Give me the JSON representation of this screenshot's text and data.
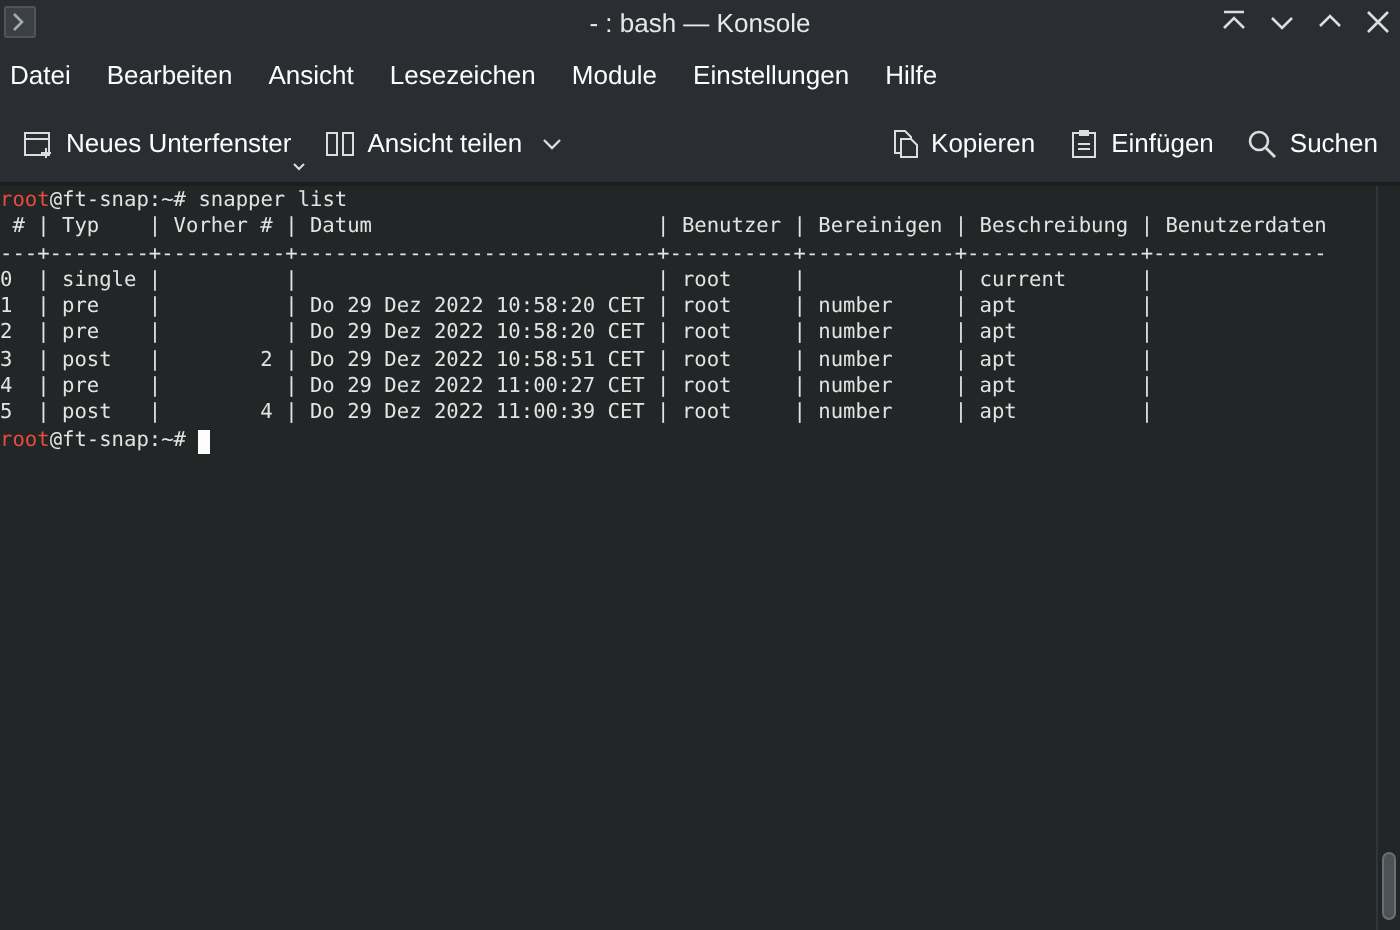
{
  "window": {
    "title": "- : bash — Konsole"
  },
  "menu": [
    "Datei",
    "Bearbeiten",
    "Ansicht",
    "Lesezeichen",
    "Module",
    "Einstellungen",
    "Hilfe"
  ],
  "toolbar": {
    "left": [
      {
        "kind": "new-tab",
        "label": "Neues Unterfenster",
        "dropdown": true
      },
      {
        "kind": "split",
        "label": "Ansicht teilen",
        "dropdown": true
      }
    ],
    "right": [
      {
        "kind": "copy",
        "label": "Kopieren"
      },
      {
        "kind": "paste",
        "label": "Einfügen"
      },
      {
        "kind": "search",
        "label": "Suchen"
      }
    ]
  },
  "terminal": {
    "lines": [
      {
        "kind": "prompt",
        "user": "root",
        "host": "@ft-snap:~# ",
        "command": "snapper list",
        "cursor": false
      },
      {
        "kind": "output",
        "text": " # | Typ    | Vorher # | Datum                       | Benutzer | Bereinigen | Beschreibung | Benutzerdaten"
      },
      {
        "kind": "output",
        "text": "---+--------+----------+-----------------------------+----------+------------+--------------+--------------"
      },
      {
        "kind": "output",
        "text": "0  | single |          |                             | root     |            | current      |"
      },
      {
        "kind": "output",
        "text": "1  | pre    |          | Do 29 Dez 2022 10:58:20 CET | root     | number     | apt          |"
      },
      {
        "kind": "output",
        "text": "2  | pre    |          | Do 29 Dez 2022 10:58:20 CET | root     | number     | apt          |"
      },
      {
        "kind": "output",
        "text": "3  | post   |        2 | Do 29 Dez 2022 10:58:51 CET | root     | number     | apt          |"
      },
      {
        "kind": "output",
        "text": "4  | pre    |          | Do 29 Dez 2022 11:00:27 CET | root     | number     | apt          |"
      },
      {
        "kind": "output",
        "text": "5  | post   |        4 | Do 29 Dez 2022 11:00:39 CET | root     | number     | apt          |"
      },
      {
        "kind": "prompt",
        "user": "root",
        "host": "@ft-snap:~# ",
        "cursor": true
      }
    ]
  }
}
